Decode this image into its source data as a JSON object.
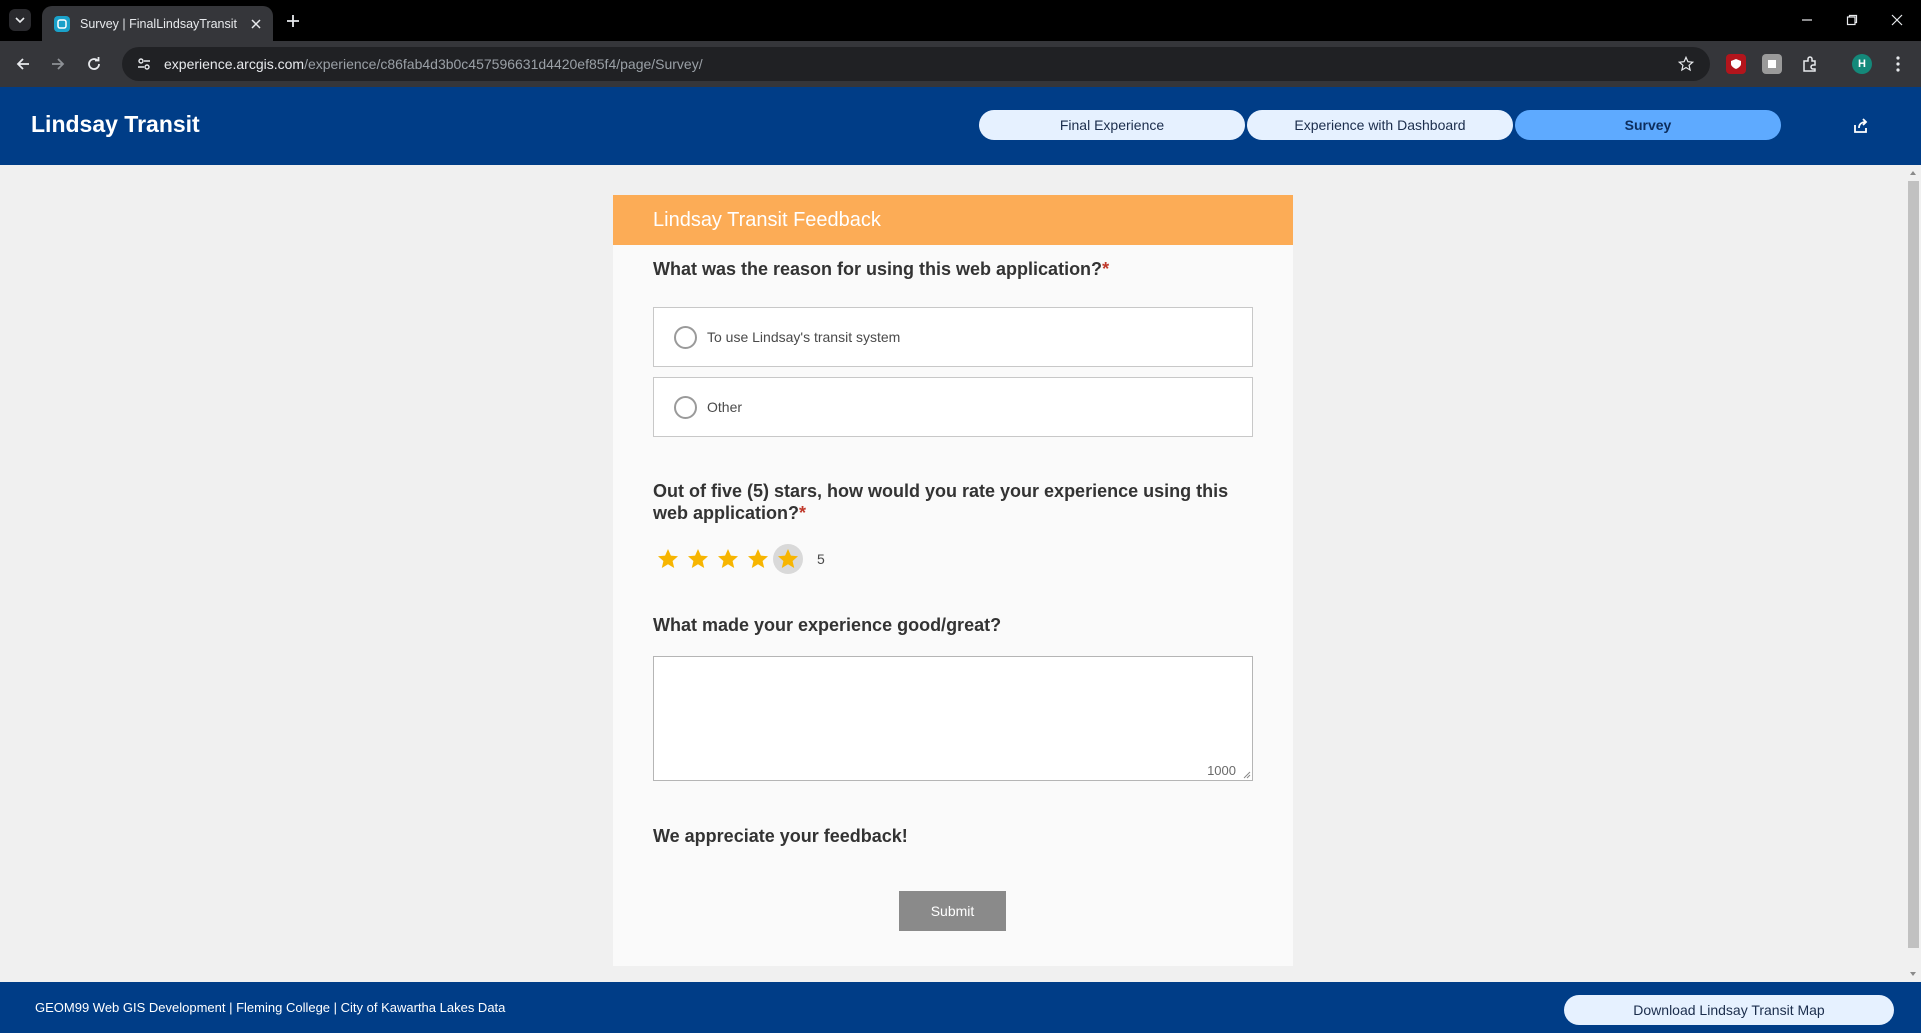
{
  "browser": {
    "tab_title": "Survey | FinalLindsayTransit",
    "url_host": "experience.arcgis.com",
    "url_path": "/experience/c86fab4d3b0c457596631d4420ef85f4/page/Survey/",
    "profile_initial": "H"
  },
  "app": {
    "title": "Lindsay Transit",
    "nav": [
      {
        "label": "Final Experience",
        "active": false
      },
      {
        "label": "Experience with Dashboard",
        "active": false
      },
      {
        "label": "Survey",
        "active": true
      }
    ],
    "accent_color": "#003d87"
  },
  "form": {
    "header": "Lindsay Transit Feedback",
    "header_color": "#fcac56",
    "q1": {
      "text": "What was the reason for using this web application?",
      "required_mark": "*",
      "options": [
        "To use Lindsay's transit system",
        "Other"
      ]
    },
    "q2": {
      "text": "Out of five (5) stars, how would you rate your experience using this web application?",
      "required_mark": "*",
      "rating": 5,
      "max_rating": 5,
      "rating_label": "5"
    },
    "q3": {
      "text": "What made your experience good/great?",
      "value": "",
      "char_limit": "1000"
    },
    "closing": "We appreciate your feedback!",
    "submit_label": "Submit"
  },
  "footer": {
    "credits": "GEOM99 Web GIS Development | Fleming College | City of Kawartha Lakes Data",
    "download_label": "Download Lindsay Transit Map"
  }
}
